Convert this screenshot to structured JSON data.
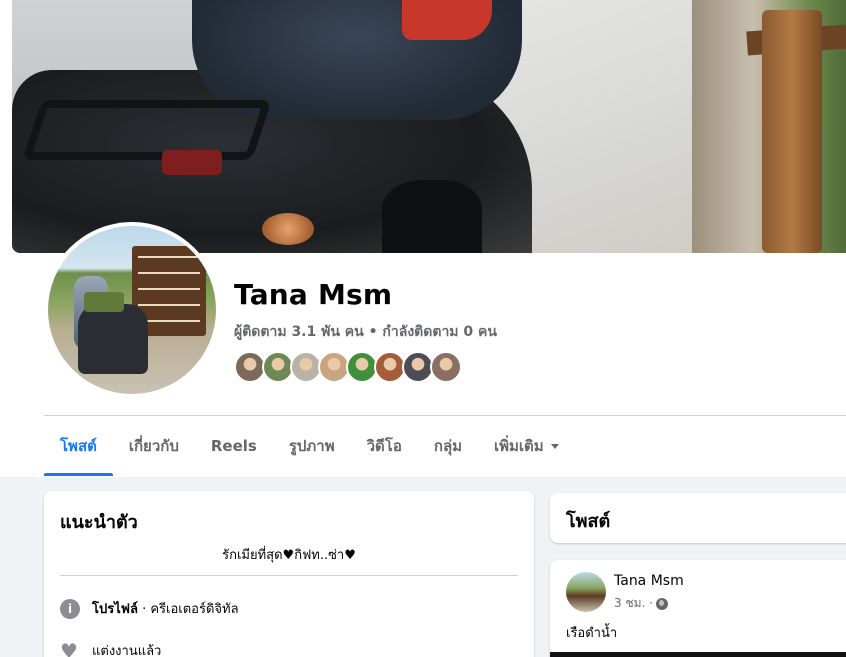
{
  "profile": {
    "name": "Tana Msm",
    "stats": "ผู้ติดตาม 3.1 พัน คน • กำลังติดตาม 0 คน",
    "friend_colors": [
      "#7b6a5a",
      "#6d8a55",
      "#b8b2a8",
      "#c9a47e",
      "#3f8f3b",
      "#a65b3a",
      "#4d4d55",
      "#8b6f62"
    ]
  },
  "tabs": [
    {
      "label": "โพสต์",
      "active": true
    },
    {
      "label": "เกี่ยวกับ"
    },
    {
      "label": "Reels"
    },
    {
      "label": "รูปภาพ"
    },
    {
      "label": "วิดีโอ"
    },
    {
      "label": "กลุ่ม"
    },
    {
      "label": "เพิ่มเติม"
    }
  ],
  "intro": {
    "title": "แนะนำตัว",
    "bio": "รักเมียที่สุด♥กิฟท..ซ่า♥",
    "profile_label": "โปรไฟล์",
    "profile_value": "· ครีเอเตอร์ดิจิทัล",
    "relationship": "แต่งงานแล้ว"
  },
  "posts": {
    "title": "โพสต์",
    "post": {
      "author": "Tana Msm",
      "time": "3 ชม. ·",
      "text": "เรือดำน้ำ"
    }
  },
  "icons": {
    "info": "info-icon",
    "heart": "heart-icon",
    "globe": "globe-icon",
    "caret": "caret-down-icon"
  }
}
